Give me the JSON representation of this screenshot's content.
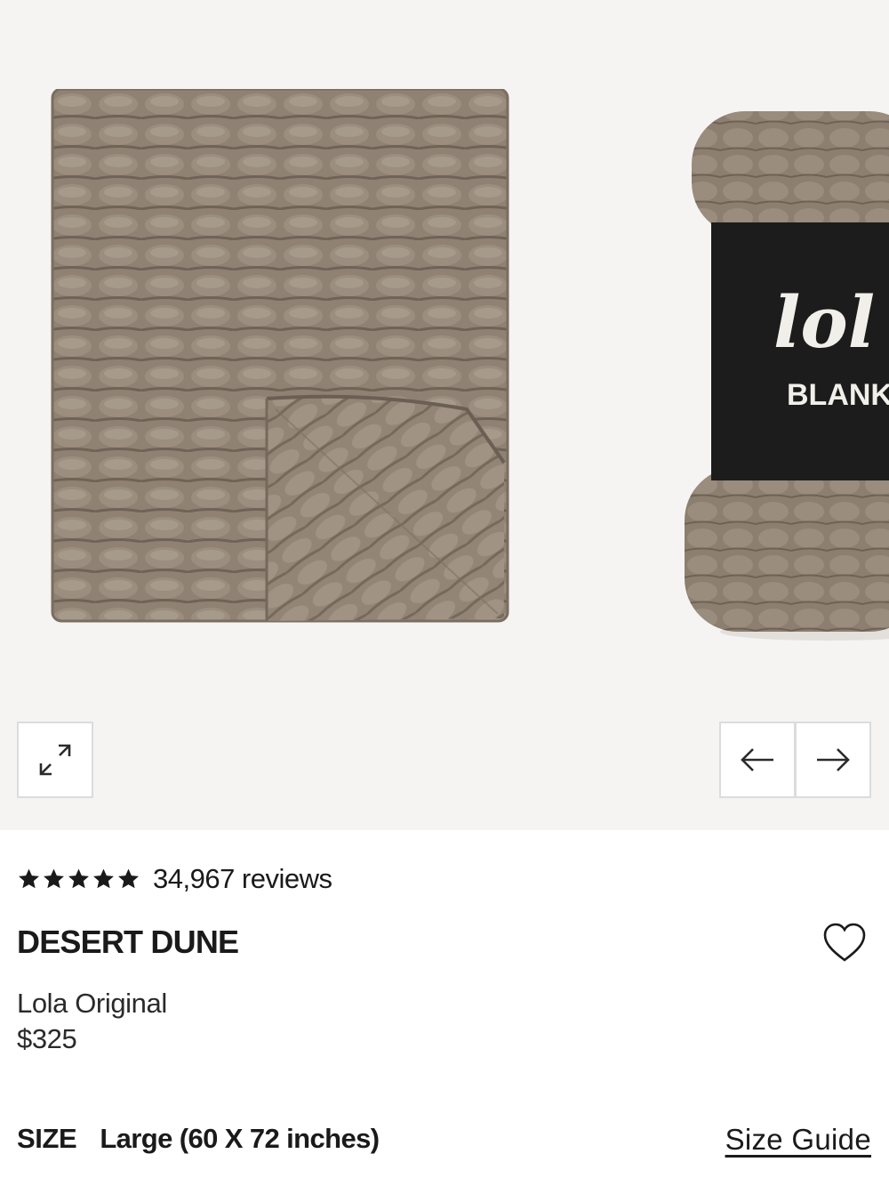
{
  "gallery": {
    "brand_logo_text": "lol",
    "brand_label_text": "BLANK",
    "product_color": "#8e8072",
    "label_color": "#1c1c1c"
  },
  "controls": {
    "expand_icon": "expand-icon",
    "prev_icon": "arrow-left-icon",
    "next_icon": "arrow-right-icon"
  },
  "rating": {
    "stars": 5,
    "reviews_text": "34,967 reviews"
  },
  "product": {
    "title": "DESERT DUNE",
    "subtitle": "Lola Original",
    "price": "$325"
  },
  "size": {
    "label": "SIZE",
    "value": "Large (60 X 72 inches)",
    "guide_link": "Size Guide"
  }
}
